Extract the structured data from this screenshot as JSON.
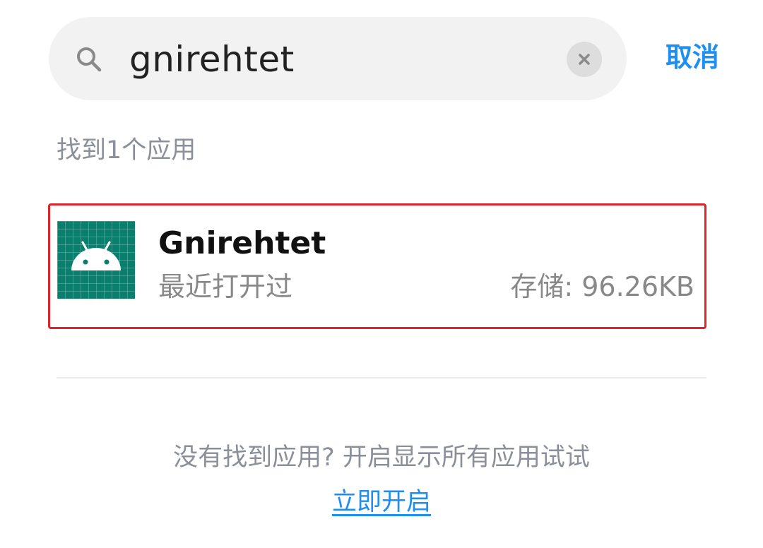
{
  "search": {
    "value": "gnirehtet",
    "placeholder": "",
    "icon": "search-icon",
    "clear_icon": "close-icon"
  },
  "header": {
    "cancel_label": "取消"
  },
  "results": {
    "count_label": "找到1个应用",
    "items": [
      {
        "name": "Gnirehtet",
        "subtitle": "最近打开过",
        "storage": "存储: 96.26KB",
        "icon": "android-app-icon"
      }
    ]
  },
  "footer": {
    "hint": "没有找到应用? 开启显示所有应用试试",
    "enable_link": "立即开启"
  },
  "colors": {
    "accent": "#1f8ef1",
    "highlight_border": "#e0232b",
    "app_icon_bg": "#0b7f6e",
    "muted_text": "#8b8f99"
  }
}
